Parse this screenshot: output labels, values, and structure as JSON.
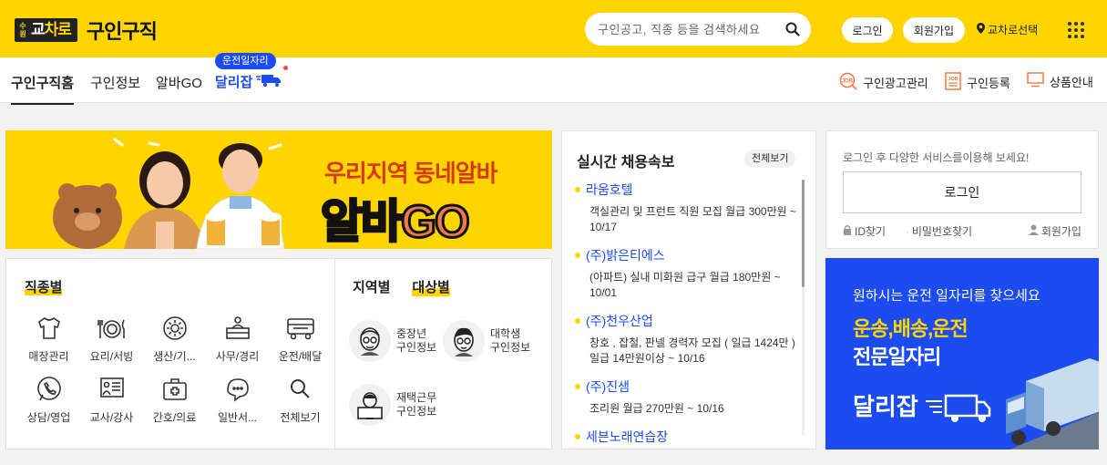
{
  "header": {
    "logo_city": [
      "수",
      "원"
    ],
    "logo_text_a": "교",
    "logo_text_b": "차로",
    "title": "구인구직",
    "search_placeholder": "구인공고, 직종 등을 검색하세요",
    "login_label": "로그인",
    "signup_label": "회원가입",
    "area_label": "교차로선택"
  },
  "nav": {
    "tabs": [
      {
        "label": "구인구직홈",
        "active": true
      },
      {
        "label": "구인정보",
        "active": false
      },
      {
        "label": "알바GO",
        "active": false
      }
    ],
    "special_tab_label": "달리잡",
    "special_tab_bubble": "운전일자리",
    "right": [
      {
        "label": "구인광고관리",
        "icon": "job-search-icon"
      },
      {
        "label": "구인등록",
        "icon": "job-register-icon"
      },
      {
        "label": "상품안내",
        "icon": "monitor-icon"
      }
    ]
  },
  "banner": {
    "line1": "우리지역 동네알바",
    "line2_a": "알바",
    "line2_b": "GO"
  },
  "categories": {
    "title": "직종별",
    "items": [
      {
        "label": "매장관리",
        "icon": "shirt-icon"
      },
      {
        "label": "요리/서빙",
        "icon": "dining-icon"
      },
      {
        "label": "생산/기...",
        "icon": "gear-icon"
      },
      {
        "label": "사무/경리",
        "icon": "desk-icon"
      },
      {
        "label": "운전/배달",
        "icon": "truck-icon"
      },
      {
        "label": "상담/영업",
        "icon": "phone-icon"
      },
      {
        "label": "교사/강사",
        "icon": "blackboard-icon"
      },
      {
        "label": "간호/의료",
        "icon": "medical-kit-icon"
      },
      {
        "label": "일반서...",
        "icon": "chat-icon"
      },
      {
        "label": "전체보기",
        "icon": "search-icon"
      }
    ]
  },
  "targets": {
    "tab_region": "지역별",
    "tab_target": "대상별",
    "items": [
      {
        "line1": "중장년",
        "line2": "구인정보",
        "icon": "senior-avatar-icon"
      },
      {
        "line1": "대학생",
        "line2": "구인정보",
        "icon": "student-avatar-icon"
      },
      {
        "line1": "재택근무",
        "line2": "구인정보",
        "icon": "remote-work-avatar-icon"
      }
    ]
  },
  "news": {
    "title": "실시간 채용속보",
    "all_label": "전체보기",
    "items": [
      {
        "company": "라움호텔",
        "desc": "객실관리 및 프런트 직원 모집 월급 300만원 ~ 10/17"
      },
      {
        "company": "(주)밝은티에스",
        "desc": "(아파트) 실내 미화원 급구 월급 180만원 ~ 10/01"
      },
      {
        "company": "(주)천우산업",
        "desc": "창호 , 잡철, 판넬 경력자 모집 ( 일급 1424만 ) 일급 14만원이상 ~ 10/16"
      },
      {
        "company": "(주)진샘",
        "desc": "조리원 월급 270만원 ~ 10/16"
      },
      {
        "company": "세븐노래연습장",
        "desc": ""
      }
    ]
  },
  "login": {
    "message": "로그인 후 다양한 서비스를이용해 보세요!",
    "button_label": "로그인",
    "find_id": "ID찾기",
    "find_pw": "비밀번호찾기",
    "signup": "회원가입"
  },
  "ad": {
    "line1": "원하시는 운전 일자리를 찾으세요",
    "line2": "운송,배송,운전",
    "line3": "전문일자리",
    "logo": "달리잡"
  },
  "colors": {
    "brand_yellow": "#ffd500",
    "brand_blue": "#1c4cf0"
  }
}
